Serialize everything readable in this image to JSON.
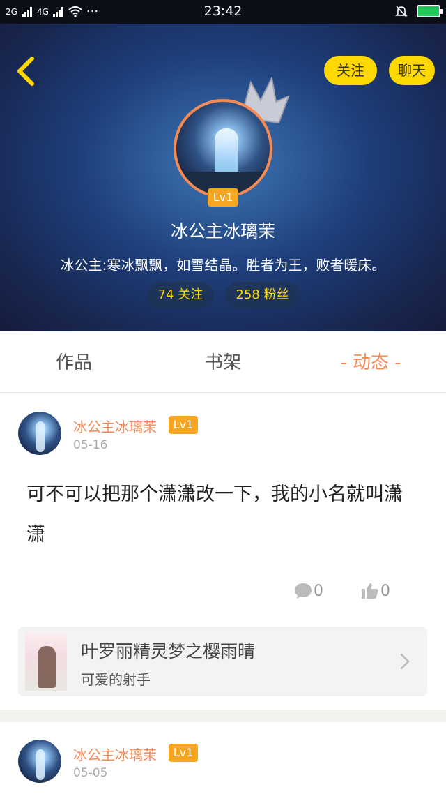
{
  "status_bar": {
    "signal_left": "2G",
    "signal_right": "4G",
    "more": "···",
    "time": "23:42"
  },
  "header": {
    "follow_button": "关注",
    "chat_button": "聊天",
    "level": "Lv1",
    "nickname": "冰公主冰璃茉",
    "bio": "冰公主:寒冰飘飘，如雪结晶。胜者为王，败者暖床。",
    "following": "74 关注",
    "fans": "258 粉丝"
  },
  "tabs": [
    {
      "label": "作品"
    },
    {
      "label": "书架"
    },
    {
      "label": "- 动态 -"
    }
  ],
  "posts": [
    {
      "author": "冰公主冰璃茉",
      "level": "Lv1",
      "date": "05-16",
      "text": "可不可以把那个潇潇改一下，我的小名就叫潇潇",
      "comments": "0",
      "likes": "0",
      "book": {
        "title": "叶罗丽精灵梦之樱雨晴",
        "author": "可爱的射手"
      }
    },
    {
      "author": "冰公主冰璃茉",
      "level": "Lv1",
      "date": "05-05"
    }
  ],
  "colors": {
    "accent_orange": "#f58a55",
    "button_yellow": "#ffd800",
    "level_badge": "#f5a623"
  }
}
